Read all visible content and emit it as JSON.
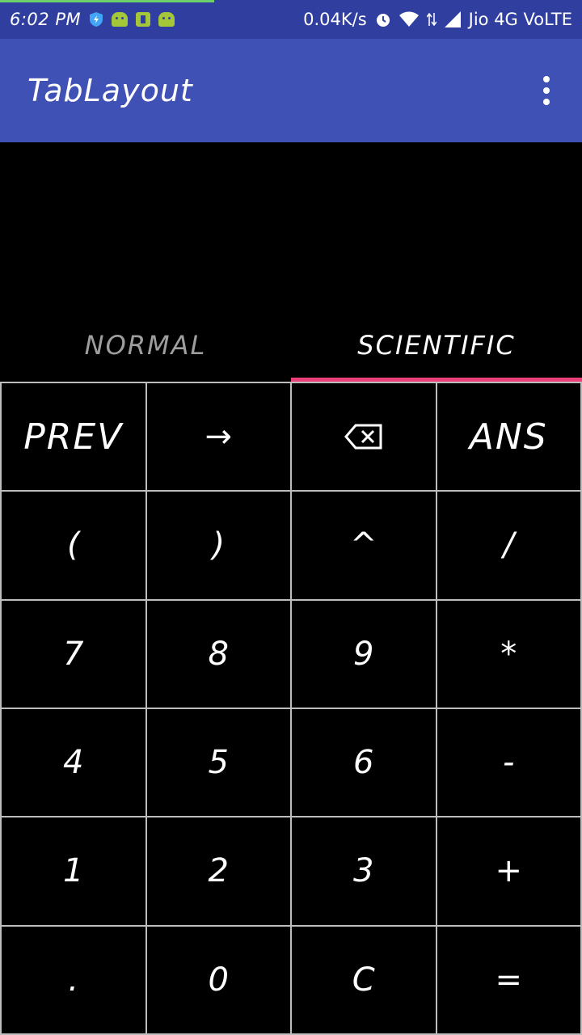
{
  "status_bar": {
    "time": "6:02 PM",
    "speed": "0.04K/s",
    "carrier": "Jio 4G VoLTE"
  },
  "toolbar": {
    "title": "TabLayout"
  },
  "tabs": [
    {
      "label": "NORMAL",
      "selected": false
    },
    {
      "label": "SCIENTIFIC",
      "selected": true
    }
  ],
  "keypad": {
    "rows": [
      [
        "PREV",
        "→",
        "⌫",
        "ANS"
      ],
      [
        "(",
        ")",
        "^",
        "/"
      ],
      [
        "7",
        "8",
        "9",
        "*"
      ],
      [
        "4",
        "5",
        "6",
        "-"
      ],
      [
        "1",
        "2",
        "3",
        "+"
      ],
      [
        ".",
        "0",
        "C",
        "="
      ]
    ]
  },
  "colors": {
    "status_bar": "#303f9f",
    "toolbar": "#3f51b5",
    "tab_indicator": "#ec407a",
    "background": "#000000",
    "grid_lines": "#bdbdbd"
  }
}
